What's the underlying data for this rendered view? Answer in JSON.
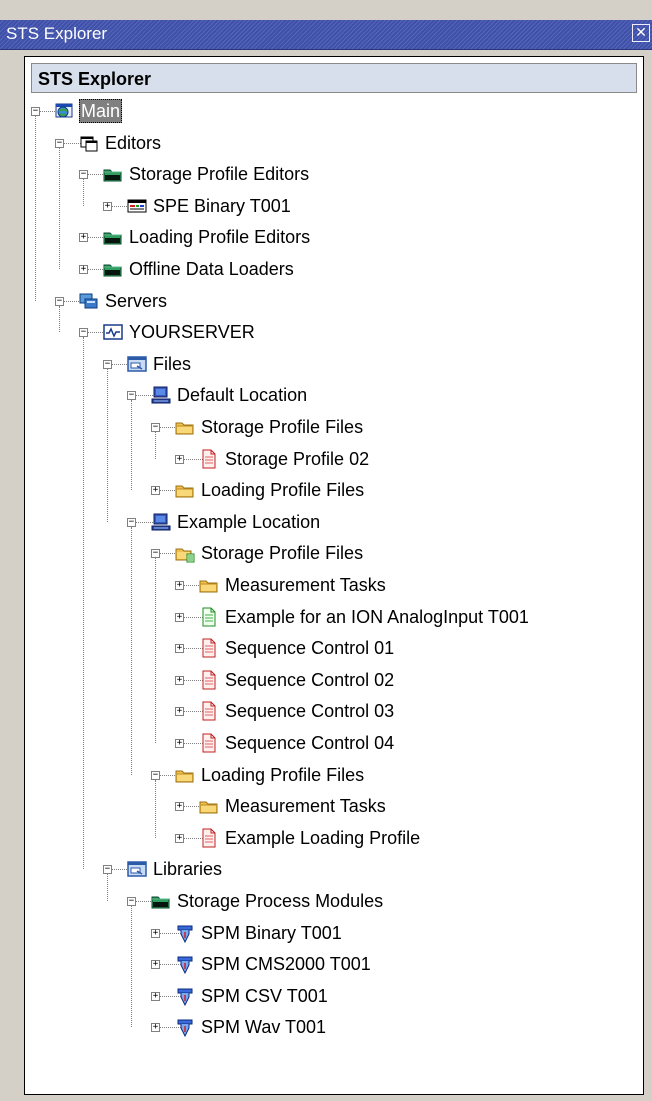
{
  "window": {
    "title": "STS Explorer"
  },
  "panel": {
    "header": "STS Explorer"
  },
  "tree": [
    {
      "label": "Main",
      "icon": "globe-window-icon",
      "depth": 0,
      "expander": "minus",
      "selected": true
    },
    {
      "label": "Editors",
      "icon": "editors-icon",
      "depth": 1,
      "expander": "minus"
    },
    {
      "label": "Storage Profile Editors",
      "icon": "folder-green-icon",
      "depth": 2,
      "expander": "minus"
    },
    {
      "label": "SPE Binary T001",
      "icon": "editor-window-icon",
      "depth": 3,
      "expander": "plus"
    },
    {
      "label": "Loading Profile Editors",
      "icon": "folder-green-icon",
      "depth": 2,
      "expander": "plus"
    },
    {
      "label": "Offline Data Loaders",
      "icon": "folder-green-icon",
      "depth": 2,
      "expander": "plus"
    },
    {
      "label": "Servers",
      "icon": "servers-icon",
      "depth": 1,
      "expander": "minus"
    },
    {
      "label": "YOURSERVER",
      "icon": "server-signal-icon",
      "depth": 2,
      "expander": "minus"
    },
    {
      "label": "Files",
      "icon": "files-panel-icon",
      "depth": 3,
      "expander": "minus"
    },
    {
      "label": "Default Location",
      "icon": "computer-icon",
      "depth": 4,
      "expander": "minus"
    },
    {
      "label": "Storage Profile Files",
      "icon": "folder-yellow-icon",
      "depth": 5,
      "expander": "minus"
    },
    {
      "label": "Storage Profile 02",
      "icon": "document-red-icon",
      "depth": 6,
      "expander": "plus"
    },
    {
      "label": "Loading Profile Files",
      "icon": "folder-yellow-icon",
      "depth": 5,
      "expander": "plus"
    },
    {
      "label": "Example Location",
      "icon": "computer-icon",
      "depth": 4,
      "expander": "minus"
    },
    {
      "label": "Storage Profile Files",
      "icon": "folder-yellow-new-icon",
      "depth": 5,
      "expander": "minus"
    },
    {
      "label": "Measurement Tasks",
      "icon": "folder-yellow-icon",
      "depth": 6,
      "expander": "plus"
    },
    {
      "label": "Example for an ION AnalogInput T001",
      "icon": "document-green-icon",
      "depth": 6,
      "expander": "plus"
    },
    {
      "label": "Sequence Control 01",
      "icon": "document-red-icon",
      "depth": 6,
      "expander": "plus"
    },
    {
      "label": "Sequence Control 02",
      "icon": "document-red-icon",
      "depth": 6,
      "expander": "plus"
    },
    {
      "label": "Sequence Control 03",
      "icon": "document-red-icon",
      "depth": 6,
      "expander": "plus"
    },
    {
      "label": "Sequence Control 04",
      "icon": "document-red-icon",
      "depth": 6,
      "expander": "plus"
    },
    {
      "label": "Loading Profile Files",
      "icon": "folder-yellow-icon",
      "depth": 5,
      "expander": "minus"
    },
    {
      "label": "Measurement Tasks",
      "icon": "folder-yellow-icon",
      "depth": 6,
      "expander": "plus"
    },
    {
      "label": "Example Loading Profile",
      "icon": "document-red-icon",
      "depth": 6,
      "expander": "plus"
    },
    {
      "label": "Libraries",
      "icon": "files-panel-icon",
      "depth": 3,
      "expander": "minus"
    },
    {
      "label": "Storage Process Modules",
      "icon": "folder-green-icon",
      "depth": 4,
      "expander": "minus"
    },
    {
      "label": "SPM Binary T001",
      "icon": "spm-module-icon",
      "depth": 5,
      "expander": "plus"
    },
    {
      "label": "SPM CMS2000 T001",
      "icon": "spm-module-icon",
      "depth": 5,
      "expander": "plus"
    },
    {
      "label": "SPM CSV T001",
      "icon": "spm-module-icon",
      "depth": 5,
      "expander": "plus"
    },
    {
      "label": "SPM Wav T001",
      "icon": "spm-module-icon",
      "depth": 5,
      "expander": "plus"
    }
  ]
}
